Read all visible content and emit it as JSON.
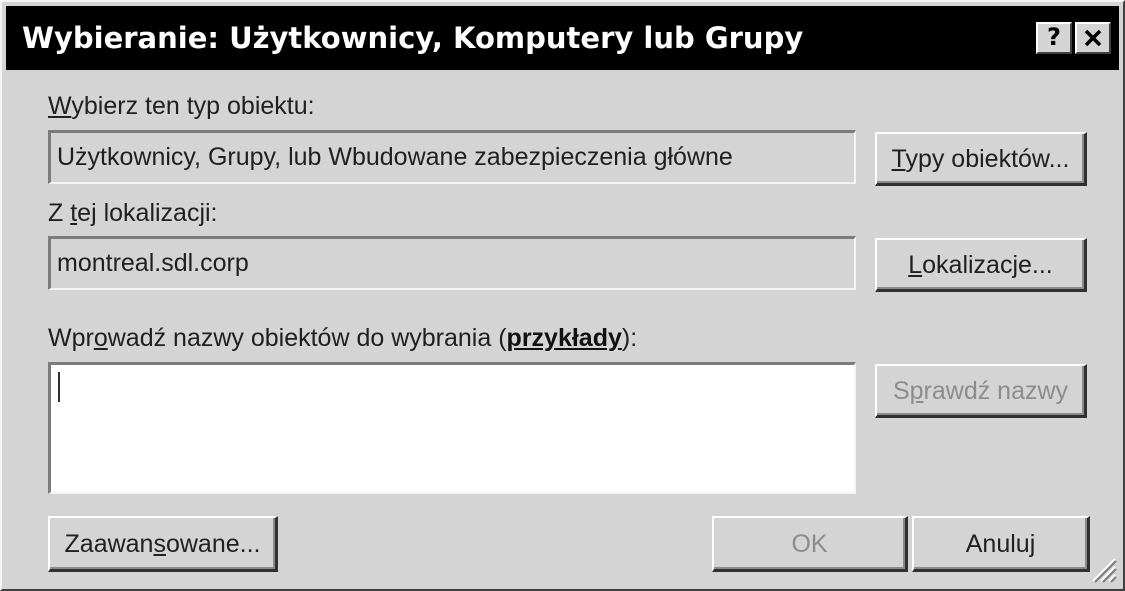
{
  "dialog": {
    "title": "Wybieranie: Użytkownicy, Komputery lub Grupy",
    "help_label": "?",
    "close_label": "✕"
  },
  "object_type": {
    "label_pre": "",
    "label_key": "W",
    "label_post": "ybierz ten typ obiektu:",
    "value": "Użytkownicy, Grupy, lub Wbudowane zabezpieczenia główne",
    "button_key": "T",
    "button_rest": "ypy obiektów..."
  },
  "location": {
    "label_pre": "Z ",
    "label_key": "t",
    "label_post": "ej lokalizacji:",
    "value": "montreal.sdl.corp",
    "button_key": "L",
    "button_rest": "okalizacje..."
  },
  "names": {
    "label_pre": "Wpr",
    "label_key": "o",
    "label_post": "wadź nazwy obiektów do wybrania (",
    "link": "przykłady",
    "label_end": "):",
    "value": "",
    "check_pre": "S",
    "check_key": "p",
    "check_post": "rawdź nazwy"
  },
  "footer": {
    "advanced_pre": "Zaawan",
    "advanced_key": "s",
    "advanced_post": "owane...",
    "ok_label": "OK",
    "cancel_label": "Anuluj"
  }
}
